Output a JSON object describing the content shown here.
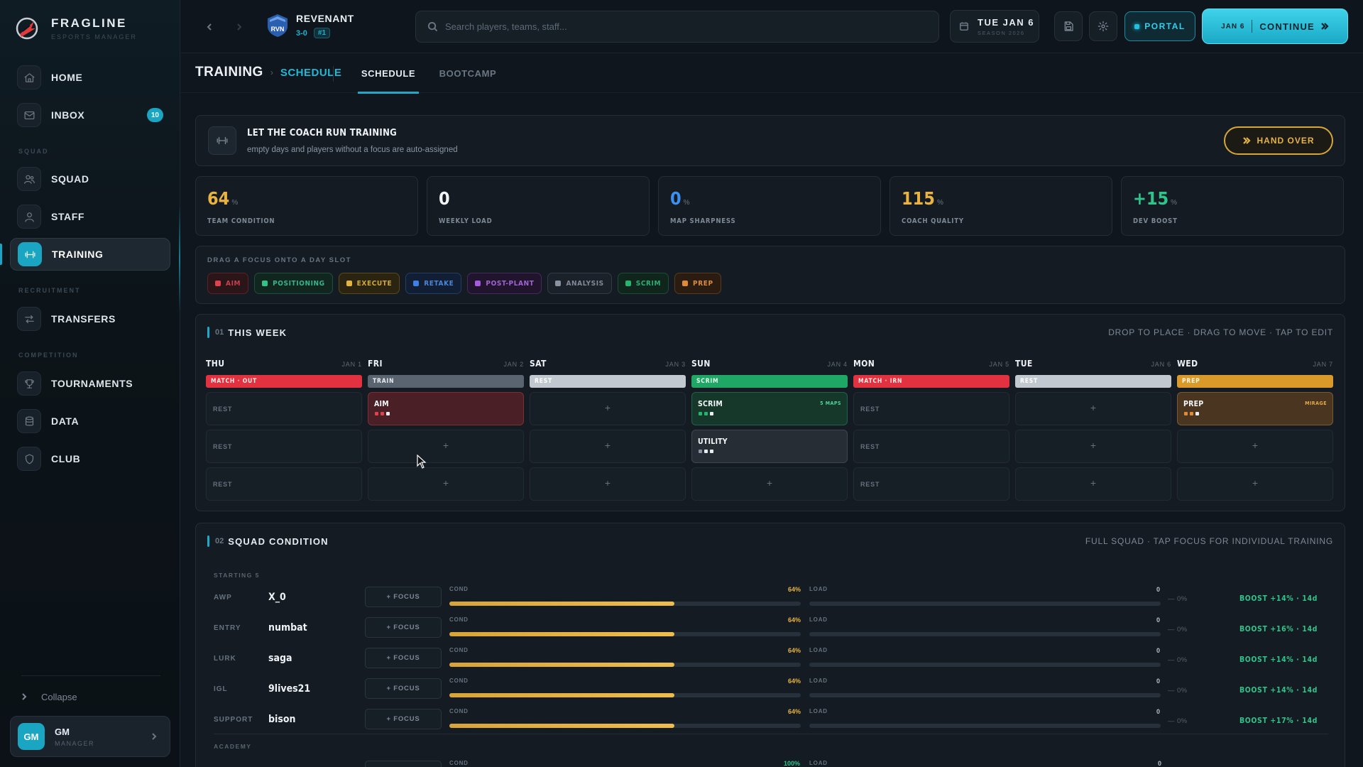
{
  "sidebar": {
    "brand": {
      "name": "FRAGLINE",
      "subtitle": "ESPORTS MANAGER"
    },
    "items": {
      "home": {
        "label": "HOME",
        "icon": "home-icon"
      },
      "inbox": {
        "label": "INBOX",
        "icon": "mail-icon",
        "badge": "10"
      },
      "squad": {
        "label": "SQUAD",
        "icon": "users-icon"
      },
      "staff": {
        "label": "STAFF",
        "icon": "user-icon"
      },
      "training": {
        "label": "TRAINING",
        "icon": "dumbbell-icon"
      },
      "transfers": {
        "label": "TRANSFERS",
        "icon": "transfer-icon"
      },
      "tournaments": {
        "label": "TOURNAMENTS",
        "icon": "trophy-icon"
      },
      "data": {
        "label": "DATA",
        "icon": "database-icon"
      },
      "club": {
        "label": "CLUB",
        "icon": "shield-icon"
      }
    },
    "sections": {
      "squad": "SQUAD",
      "recruitment": "RECRUITMENT",
      "competition": "COMPETITION"
    },
    "collapse_label": "Collapse",
    "user": {
      "initials": "GM",
      "name": "GM",
      "role": "MANAGER"
    }
  },
  "topbar": {
    "team": {
      "abbr": "RVN",
      "name": "REVENANT",
      "record": "3-0",
      "rank": "#1"
    },
    "search_placeholder": "Search players, teams, staff...",
    "date": {
      "main": "TUE JAN 6",
      "sub": "SEASON 2026"
    },
    "portal_label": "PORTAL",
    "continue": {
      "date": "JAN 6",
      "label": "CONTINUE"
    }
  },
  "subheader": {
    "crumb_main": "TRAINING",
    "crumb_sub": "SCHEDULE",
    "tabs": {
      "schedule": "SCHEDULE",
      "bootcamp": "BOOTCAMP"
    }
  },
  "coach": {
    "title": "LET THE COACH RUN TRAINING",
    "subtitle": "empty days and players without a focus are auto-assigned",
    "button": "HAND OVER"
  },
  "stats": {
    "condition": {
      "value": "64",
      "unit": "%",
      "label": "TEAM CONDITION",
      "color": "#e8b341"
    },
    "load": {
      "value": "0",
      "unit": "",
      "label": "WEEKLY LOAD",
      "color": "#f1f4f7"
    },
    "sharpness": {
      "value": "0",
      "unit": "%",
      "label": "MAP SHARPNESS",
      "color": "#3d8ff0"
    },
    "quality": {
      "value": "115",
      "unit": "%",
      "label": "COACH QUALITY",
      "color": "#e8b341"
    },
    "boost": {
      "value": "+15",
      "unit": "%",
      "label": "DEV BOOST",
      "color": "#2fc58a"
    }
  },
  "palette": {
    "title": "DRAG A FOCUS ONTO A DAY SLOT",
    "chips": {
      "aim": "AIM",
      "positioning": "POSITIONING",
      "execute": "EXECUTE",
      "retake": "RETAKE",
      "postplant": "POST-PLANT",
      "analysis": "ANALYSIS",
      "scrim": "SCRIM",
      "prep": "PREP"
    }
  },
  "week": {
    "num": "01",
    "title": "THIS WEEK",
    "hint": "DROP TO PLACE · DRAG TO MOVE · TAP TO EDIT",
    "days": {
      "thu": {
        "name": "THU",
        "date": "JAN 1",
        "tag": "MATCH · OUT"
      },
      "fri": {
        "name": "FRI",
        "date": "JAN 2",
        "tag": "TRAIN"
      },
      "sat": {
        "name": "SAT",
        "date": "JAN 3",
        "tag": "REST"
      },
      "sun": {
        "name": "SUN",
        "date": "JAN 4",
        "tag": "SCRIM"
      },
      "mon": {
        "name": "MON",
        "date": "JAN 5",
        "tag": "MATCH · IRN"
      },
      "tue": {
        "name": "TUE",
        "date": "JAN 6",
        "tag": "REST"
      },
      "wed": {
        "name": "WED",
        "date": "JAN 7",
        "tag": "PREP"
      }
    },
    "rest": "REST",
    "plus": "+",
    "slots": {
      "fri_aim": "AIM",
      "sun_scrim": "SCRIM",
      "sun_scrim_meta": "5 MAPS",
      "sun_utility": "UTILITY",
      "wed_prep": "PREP",
      "wed_prep_meta": "MIRAGE"
    }
  },
  "squad": {
    "num": "02",
    "title": "SQUAD CONDITION",
    "hint": "FULL SQUAD · TAP FOCUS FOR INDIVIDUAL TRAINING",
    "starting_label": "STARTING 5",
    "academy_label": "ACADEMY",
    "focus_label": "+ FOCUS",
    "cond_label": "COND",
    "load_label": "LOAD",
    "players": [
      {
        "role": "AWP",
        "name": "X_0",
        "cond": "64%",
        "cond_pct": 64,
        "load": "0",
        "load_pct": 0,
        "delta": "— 0%",
        "boost": "BOOST +14% · 14d"
      },
      {
        "role": "ENTRY",
        "name": "numbat",
        "cond": "64%",
        "cond_pct": 64,
        "load": "0",
        "load_pct": 0,
        "delta": "— 0%",
        "boost": "BOOST +16% · 14d"
      },
      {
        "role": "LURK",
        "name": "saga",
        "cond": "64%",
        "cond_pct": 64,
        "load": "0",
        "load_pct": 0,
        "delta": "— 0%",
        "boost": "BOOST +14% · 14d"
      },
      {
        "role": "IGL",
        "name": "9lives21",
        "cond": "64%",
        "cond_pct": 64,
        "load": "0",
        "load_pct": 0,
        "delta": "— 0%",
        "boost": "BOOST +14% · 14d"
      },
      {
        "role": "SUPPORT",
        "name": "bison",
        "cond": "64%",
        "cond_pct": 64,
        "load": "0",
        "load_pct": 0,
        "delta": "— 0%",
        "boost": "BOOST +17% · 14d"
      }
    ],
    "academy_partial": {
      "cond": "100%",
      "load": "0"
    }
  }
}
